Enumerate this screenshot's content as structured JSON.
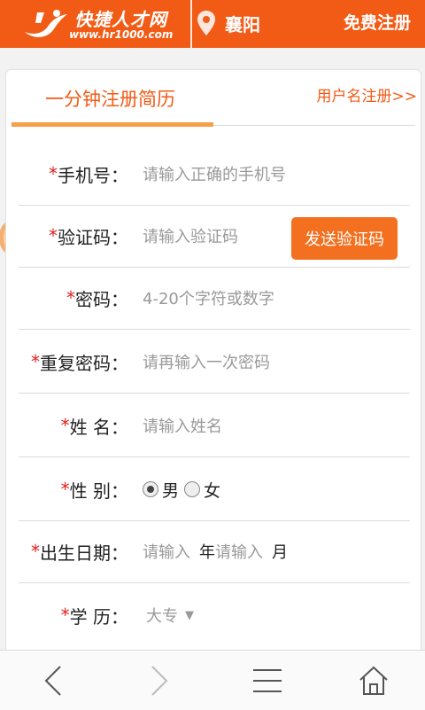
{
  "header": {
    "brand": "快捷人才网",
    "url": "www.hr1000.com",
    "city": "襄阳",
    "register": "免费注册",
    "brand_color": "#f25b16"
  },
  "tabs": {
    "active": "一分钟注册简历",
    "alt_link": "用户名注册>>"
  },
  "form": {
    "phone": {
      "required": "*",
      "label": "手机号：",
      "placeholder": "请输入正确的手机号"
    },
    "code": {
      "required": "*",
      "label": "验证码：",
      "placeholder": "请输入验证码",
      "button": "发送验证码"
    },
    "password": {
      "required": "*",
      "label": "密码：",
      "placeholder": "4-20个字符或数字"
    },
    "repeat": {
      "required": "*",
      "label": "重复密码：",
      "placeholder": "请再输入一次密码"
    },
    "name": {
      "required": "*",
      "label": "姓 名：",
      "placeholder": "请输入姓名"
    },
    "gender": {
      "required": "*",
      "label": "性 别：",
      "options": [
        "男",
        "女"
      ],
      "selected": "男"
    },
    "birth": {
      "required": "*",
      "label": "出生日期：",
      "year_placeholder": "请输入",
      "year_unit": "年",
      "month_placeholder": "请输入",
      "month_unit": "月"
    },
    "education": {
      "required": "*",
      "label": "学 历：",
      "value": "大专",
      "arrow": "▼"
    }
  },
  "nav": {
    "icons": [
      "back-icon",
      "forward-icon",
      "menu-icon",
      "home-icon"
    ]
  }
}
